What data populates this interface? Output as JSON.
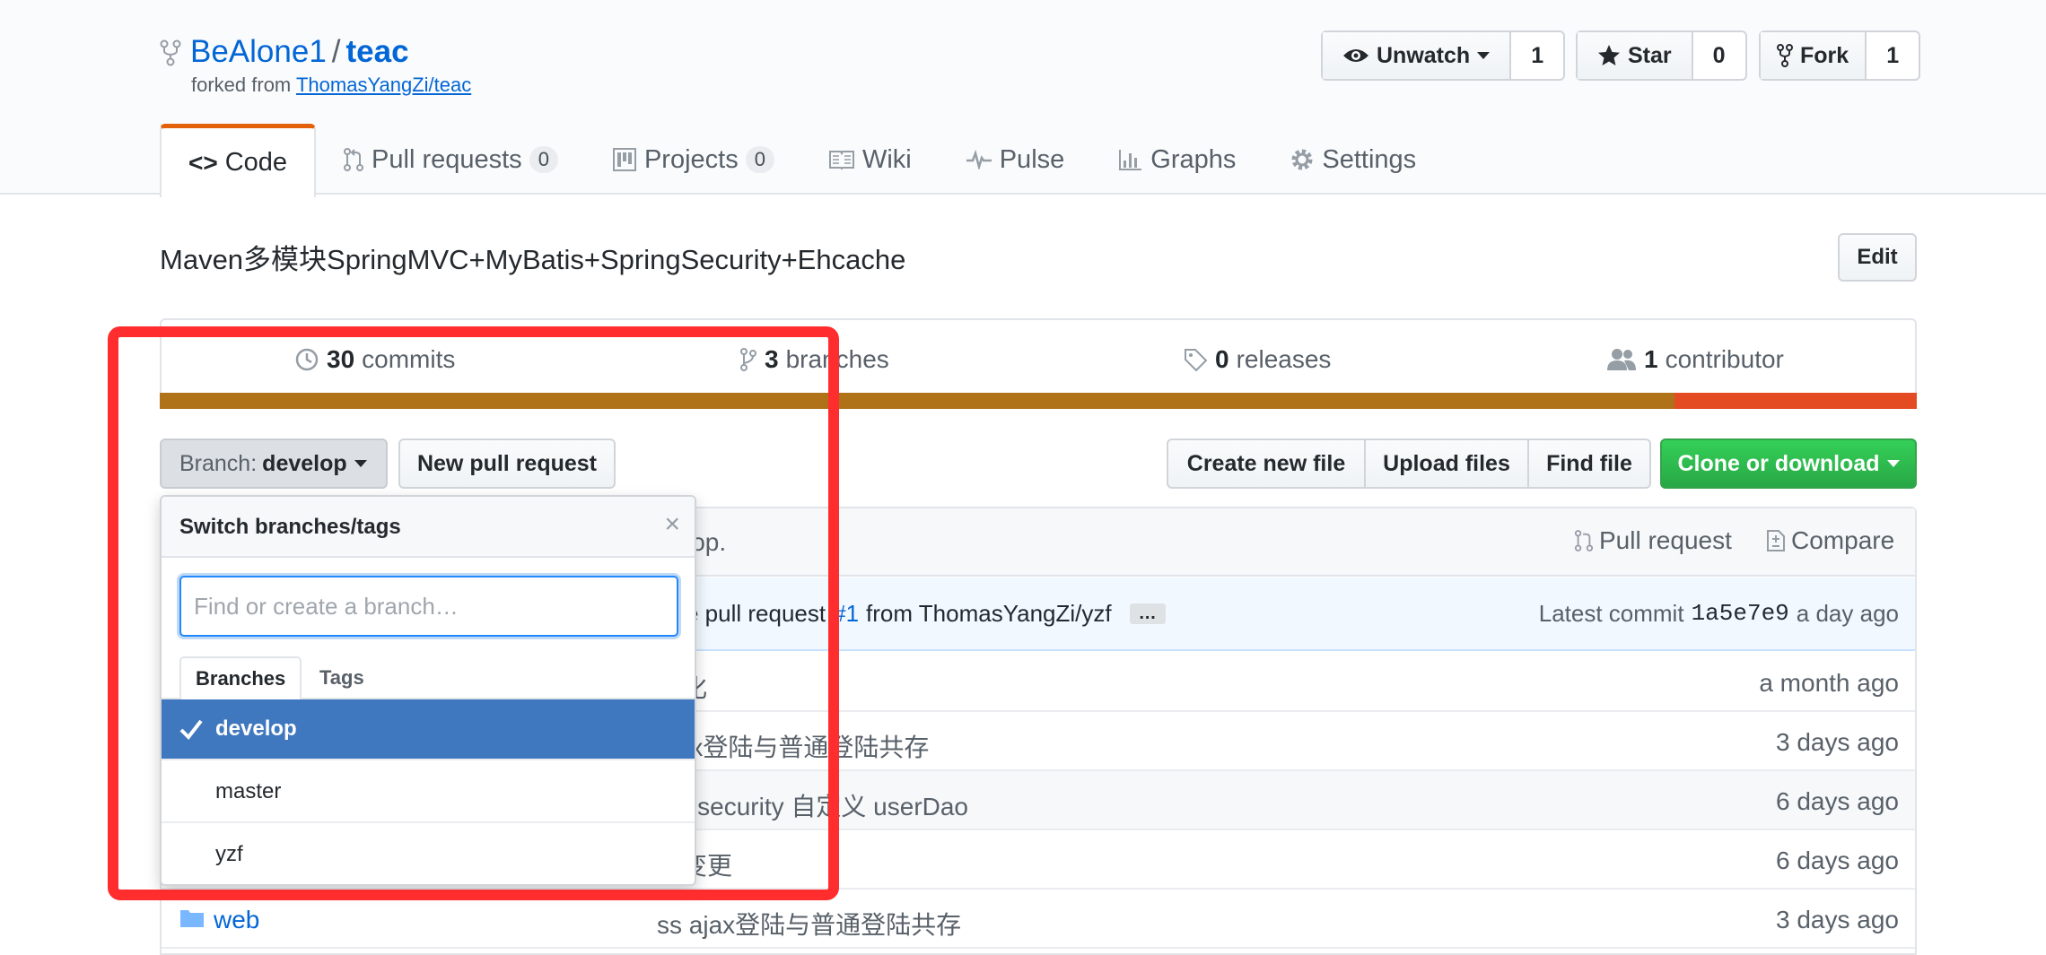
{
  "repo": {
    "owner": "BeAlone1",
    "separator": "/",
    "name": "teac",
    "forked_from_prefix": "forked from",
    "forked_from": "ThomasYangZi/teac"
  },
  "actions": {
    "watch_label": "Unwatch",
    "watch_count": "1",
    "star_label": "Star",
    "star_count": "0",
    "fork_label": "Fork",
    "fork_count": "1"
  },
  "tabs": [
    {
      "label": "Code",
      "count": ""
    },
    {
      "label": "Pull requests",
      "count": "0"
    },
    {
      "label": "Projects",
      "count": "0"
    },
    {
      "label": "Wiki",
      "count": ""
    },
    {
      "label": "Pulse",
      "count": ""
    },
    {
      "label": "Graphs",
      "count": ""
    },
    {
      "label": "Settings",
      "count": ""
    }
  ],
  "description": "Maven多模块SpringMVC+MyBatis+SpringSecurity+Ehcache",
  "edit_label": "Edit",
  "summary": {
    "commits_num": "30",
    "commits_label": "commits",
    "branches_num": "3",
    "branches_label": "branches",
    "releases_num": "0",
    "releases_label": "releases",
    "contributors_num": "1",
    "contributors_label": "contributor"
  },
  "language_bar": {
    "primary_color": "#b07219",
    "secondary_color": "#e44b23",
    "primary_fraction": 0.862
  },
  "toolbar": {
    "branch_prefix": "Branch:",
    "branch_name": "develop",
    "new_pr": "New pull request",
    "create_file": "Create new file",
    "upload_files": "Upload files",
    "find_file": "Find file",
    "clone": "Clone or download"
  },
  "table": {
    "head_partial": "lop.",
    "pull_request": "Pull request",
    "compare": "Compare",
    "commit_msg_partial": "e pull request",
    "commit_pr": "#1",
    "commit_from": "from ThomasYangZi/yzf",
    "ellipsis": "…",
    "latest_commit_label": "Latest commit",
    "latest_commit_sha": "1a5e7e9",
    "latest_commit_age": "a day ago",
    "rows": [
      {
        "name": "",
        "msg": "始化",
        "age": "a month ago"
      },
      {
        "name": "",
        "msg": "ajax登陆与普通登陆共存",
        "age": "3 days ago"
      },
      {
        "name": "",
        "msg": "ing security 自定义 userDao",
        "age": "6 days ago"
      },
      {
        "name": "",
        "msg": "名变更",
        "age": "6 days ago"
      },
      {
        "name": "web",
        "msg": "ss ajax登陆与普通登陆共存",
        "age": "3 days ago"
      }
    ]
  },
  "dropdown": {
    "title": "Switch branches/tags",
    "close": "×",
    "input_placeholder": "Find or create a branch…",
    "tab_branches": "Branches",
    "tab_tags": "Tags",
    "branches": [
      "develop",
      "master",
      "yzf"
    ],
    "selected": "develop"
  },
  "annotation_color": "#ff2d2d"
}
